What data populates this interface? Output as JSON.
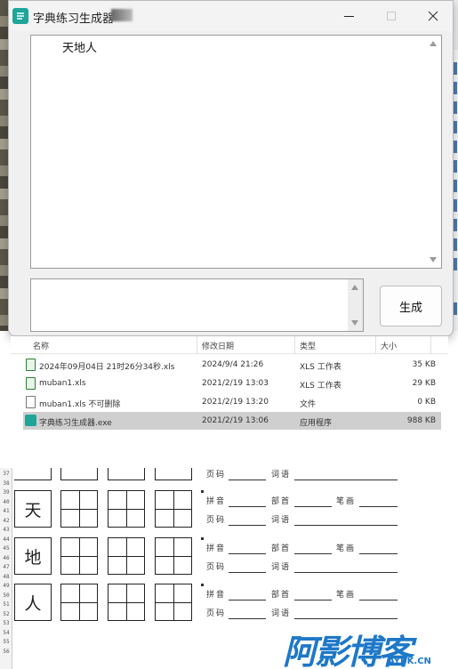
{
  "window": {
    "title": "字典练习生成器",
    "main_text": "天地人",
    "small_text": "",
    "generate_label": "生成"
  },
  "file_list": {
    "columns": [
      "名称",
      "修改日期",
      "类型",
      "大小"
    ],
    "rows": [
      {
        "name": "2024年09月04日  21时26分34秒.xls",
        "date": "2024/9/4 21:26",
        "type": "XLS 工作表",
        "size": "35 KB",
        "icon": "xls-file-icon",
        "selected": false
      },
      {
        "name": "muban1.xls",
        "date": "2021/2/19 13:03",
        "type": "XLS 工作表",
        "size": "29 KB",
        "icon": "xls-file-icon",
        "selected": false
      },
      {
        "name": "muban1.xls 不可删除",
        "date": "2021/2/19 13:20",
        "type": "文件",
        "size": "0 KB",
        "icon": "file-icon",
        "selected": false
      },
      {
        "name": "字典练习生成器.exe",
        "date": "2021/2/19 13:06",
        "type": "应用程序",
        "size": "988 KB",
        "icon": "app-icon",
        "selected": true
      }
    ]
  },
  "sheet": {
    "row_numbers": [
      "37",
      "38",
      "39",
      "40",
      "41",
      "42",
      "43",
      "44",
      "45",
      "46",
      "47",
      "48",
      "49",
      "50",
      "51",
      "52",
      "53",
      "54",
      "55",
      "56"
    ],
    "characters": [
      "天",
      "地",
      "人"
    ],
    "labels": {
      "pinyin": "拼音",
      "radical": "部首",
      "strokes": "笔画",
      "page": "页码",
      "words": "词语"
    }
  },
  "watermark": {
    "brand": "阿影博客",
    "domain": "AYBK.CN"
  },
  "colors": {
    "accent": "#1fa59a",
    "watermark": "#1e78c8",
    "selected_row": "#cfcfcf"
  }
}
